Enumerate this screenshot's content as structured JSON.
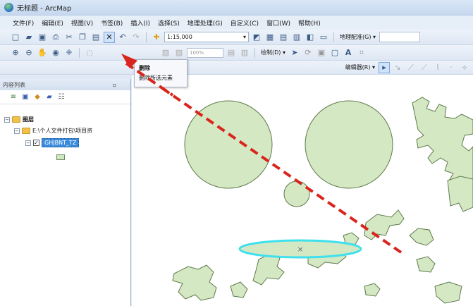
{
  "window": {
    "title": "无标题 - ArcMap"
  },
  "menu": [
    "文件(F)",
    "编辑(E)",
    "视图(V)",
    "书签(B)",
    "插入(I)",
    "选择(S)",
    "地理处理(G)",
    "自定义(C)",
    "窗口(W)",
    "帮助(H)"
  ],
  "toolbar": {
    "scale": "1:15,000",
    "georef_label": "地理配准(G) ▾",
    "zoom_pct": "100%",
    "draw_label": "绘制(D) ▾",
    "editor_label": "编辑器(R) ▾"
  },
  "tooltip": {
    "title": "删除",
    "body": "删除所选元素"
  },
  "toc": {
    "header": "内容列表",
    "root": "图层",
    "folder": "E:\\个人文件打包\\项目资",
    "layer": "GHJBNT_TZ"
  },
  "colors": {
    "polygon_fill": "#d5e8c4",
    "polygon_stroke": "#5d7a4a",
    "selection": "#3fe0ee",
    "arrow": "#d9251c"
  }
}
